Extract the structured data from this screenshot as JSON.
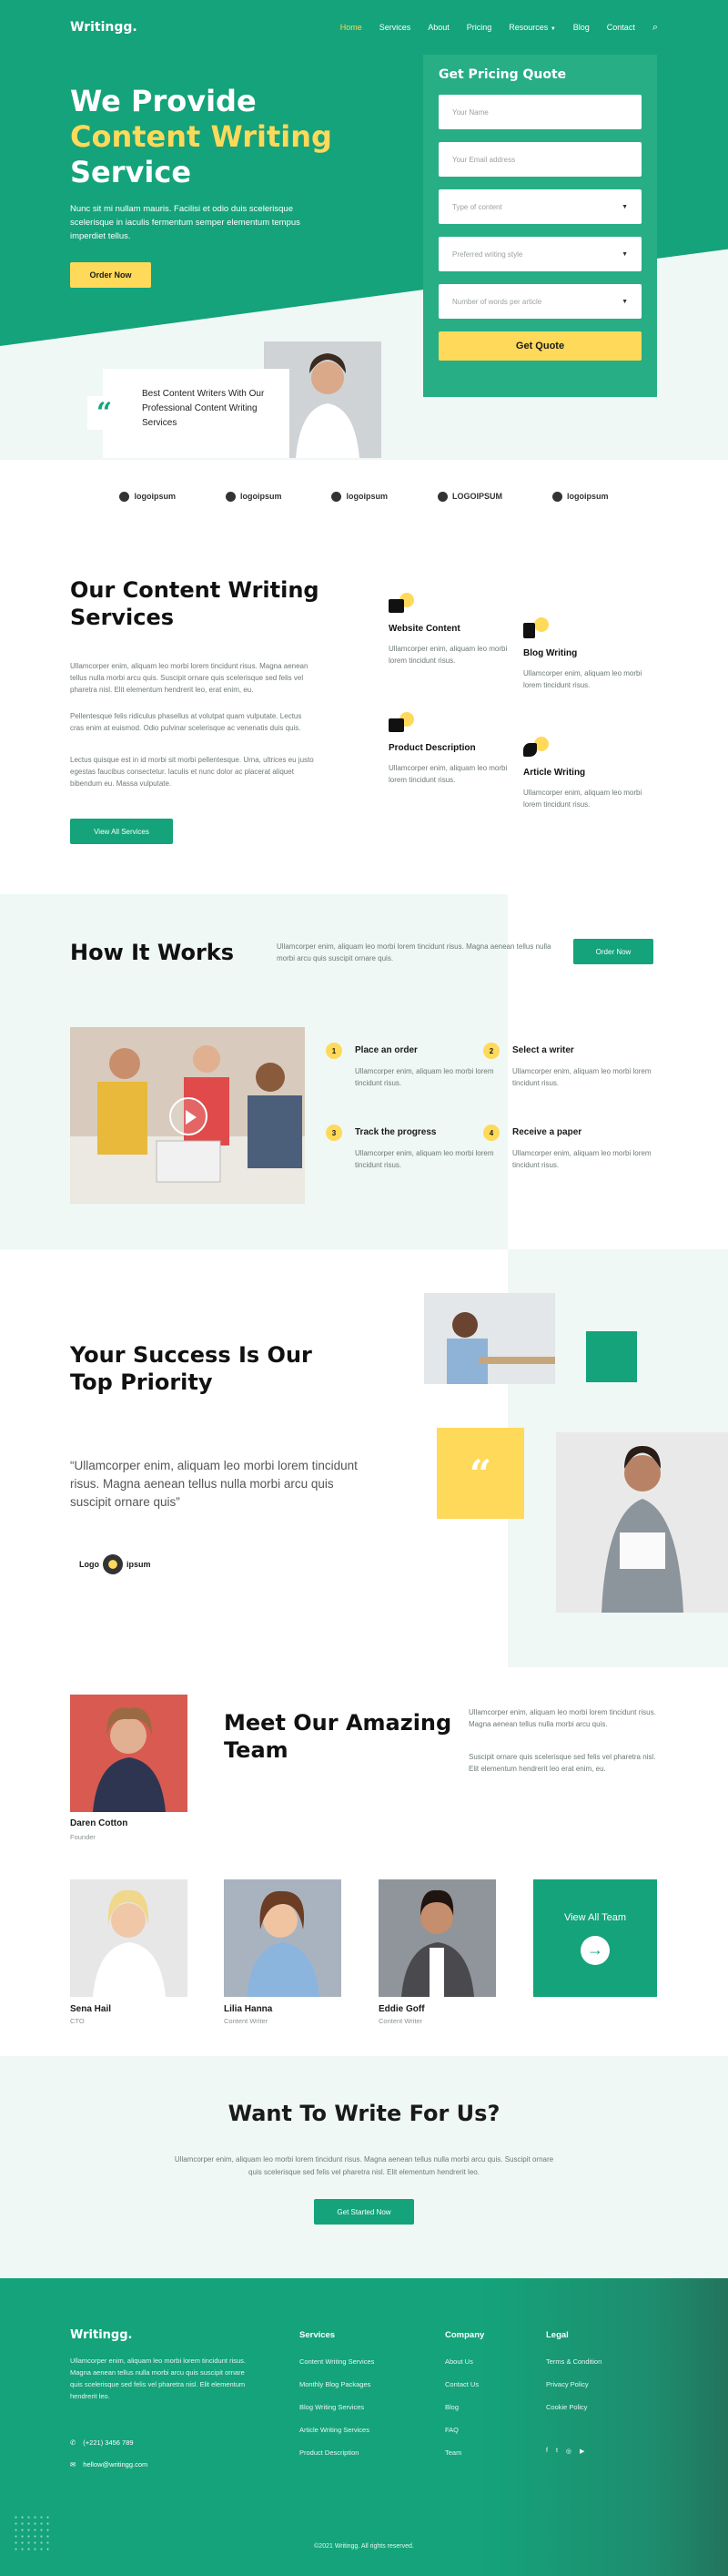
{
  "nav": {
    "logo": "Writingg.",
    "links": [
      "Home",
      "Services",
      "About",
      "Pricing",
      "Resources",
      "Blog",
      "Contact"
    ]
  },
  "hero": {
    "title_1": "We Provide",
    "title_2": "Content Writing",
    "title_3": "Service",
    "text": "Nunc sit mi nullam mauris. Facilisi et odio duis scelerisque scelerisque in iaculis fermentum semper elementum tempus imperdiet tellus.",
    "cta": "Order Now",
    "card_text": "Best Content Writers With Our Professional Content Writing Services"
  },
  "quote_form": {
    "title": "Get Pricing Quote",
    "name_placeholder": "Your Name",
    "email_placeholder": "Your Email address",
    "content_type": "Type of content",
    "writing_style": "Preferred writing style",
    "word_count": "Number of words per article",
    "submit": "Get Quote"
  },
  "logos": [
    "logoipsum",
    "logoipsum",
    "logoipsum",
    "LOGOIPSUM",
    "logoipsum"
  ],
  "services": {
    "title_1": "Our Content Writing",
    "title_2": "Services",
    "p1": "Ullamcorper enim, aliquam leo morbi lorem tincidunt risus. Magna aenean tellus nulla morbi arcu quis. Suscipit ornare quis scelerisque sed felis vel pharetra nisl. Elit elementum hendrerit leo, erat enim, eu.",
    "p2": "Pellentesque felis ridiculus phasellus at volutpat quam vulputate. Lectus cras enim at euismod. Odio pulvinar scelerisque ac venenatis duis quis.",
    "p3": "Lectus quisque est in id morbi sit morbi pellentesque. Urna, ultrices eu justo egestas faucibus consectetur. Iaculis et nunc dolor ac placerat aliquet bibendum eu. Massa vulputate.",
    "cta": "View All Services",
    "items": [
      {
        "title": "Website Content",
        "text": "Ullamcorper enim, aliquam leo morbi lorem tincidunt risus."
      },
      {
        "title": "Blog Writing",
        "text": "Ullamcorper enim, aliquam leo morbi lorem tincidunt risus."
      },
      {
        "title": "Product Description",
        "text": "Ullamcorper enim, aliquam leo morbi lorem tincidunt risus."
      },
      {
        "title": "Article Writing",
        "text": "Ullamcorper enim, aliquam leo morbi lorem tincidunt risus."
      }
    ]
  },
  "how": {
    "title": "How It Works",
    "intro": "Ullamcorper enim, aliquam leo morbi lorem tincidunt risus. Magna aenean tellus nulla morbi arcu quis suscipit ornare quis.",
    "cta": "Order Now",
    "steps": [
      {
        "num": "1",
        "title": "Place an order",
        "text": "Ullamcorper enim, aliquam leo morbi lorem tincidunt risus."
      },
      {
        "num": "2",
        "title": "Select a writer",
        "text": "Ullamcorper enim, aliquam leo morbi lorem tincidunt risus."
      },
      {
        "num": "3",
        "title": "Track the progress",
        "text": "Ullamcorper enim, aliquam leo morbi lorem tincidunt risus."
      },
      {
        "num": "4",
        "title": "Receive a paper",
        "text": "Ullamcorper enim, aliquam leo morbi lorem tincidunt risus."
      }
    ]
  },
  "success": {
    "title_1": "Your Success Is Our",
    "title_2": "Top Priority",
    "quote": "“Ullamcorper enim, aliquam leo morbi lorem tincidunt risus. Magna aenean tellus nulla morbi arcu quis suscipit ornare quis”",
    "logo_a": "Logo",
    "logo_b": "ipsum"
  },
  "team": {
    "title_1": "Meet Our Amazing",
    "title_2": "Team",
    "p1": "Ullamcorper enim, aliquam leo morbi lorem tincidunt risus. Magna aenean tellus nulla morbi arcu quis.",
    "p2": "Suscipit ornare quis scelerisque sed felis vel pharetra nisl. Elit elementum hendrerit leo erat enim, eu.",
    "members": [
      {
        "name": "Daren Cotton",
        "role": "Founder"
      },
      {
        "name": "Sena Hail",
        "role": "CTO"
      },
      {
        "name": "Lilia Hanna",
        "role": "Content Writer"
      },
      {
        "name": "Eddie Goff",
        "role": "Content Writer"
      }
    ],
    "view_all": "View All Team"
  },
  "write": {
    "title": "Want To Write For Us?",
    "text": "Ullamcorper enim, aliquam leo morbi lorem tincidunt risus. Magna aenean tellus nulla morbi arcu quis. Suscipit ornare quis scelerisque sed felis vel pharetra nisl. Elit elementum hendrerit leo.",
    "cta": "Get Started Now"
  },
  "footer": {
    "logo": "Writingg.",
    "text": "Ullamcorper enim, aliquam leo morbi lorem tincidunt risus. Magna aenean tellus nulla morbi arcu quis suscipit ornare quis scelerisque sed felis vel pharetra nisl. Elit elementum hendrerit leo.",
    "phone": "(+221) 3456 789",
    "email": "hellow@writingg.com",
    "services_title": "Services",
    "services": [
      "Content Writing Services",
      "Monthly Blog Packages",
      "Blog Writing Services",
      "Article Writing Services",
      "Product Description"
    ],
    "company_title": "Company",
    "company": [
      "About Us",
      "Contact Us",
      "Blog",
      "FAQ",
      "Team"
    ],
    "legal_title": "Legal",
    "legal": [
      "Terms & Condition",
      "Privacy Policy",
      "Cookie Policy"
    ],
    "copyright": "©2021 Writingg. All rights reserved."
  }
}
